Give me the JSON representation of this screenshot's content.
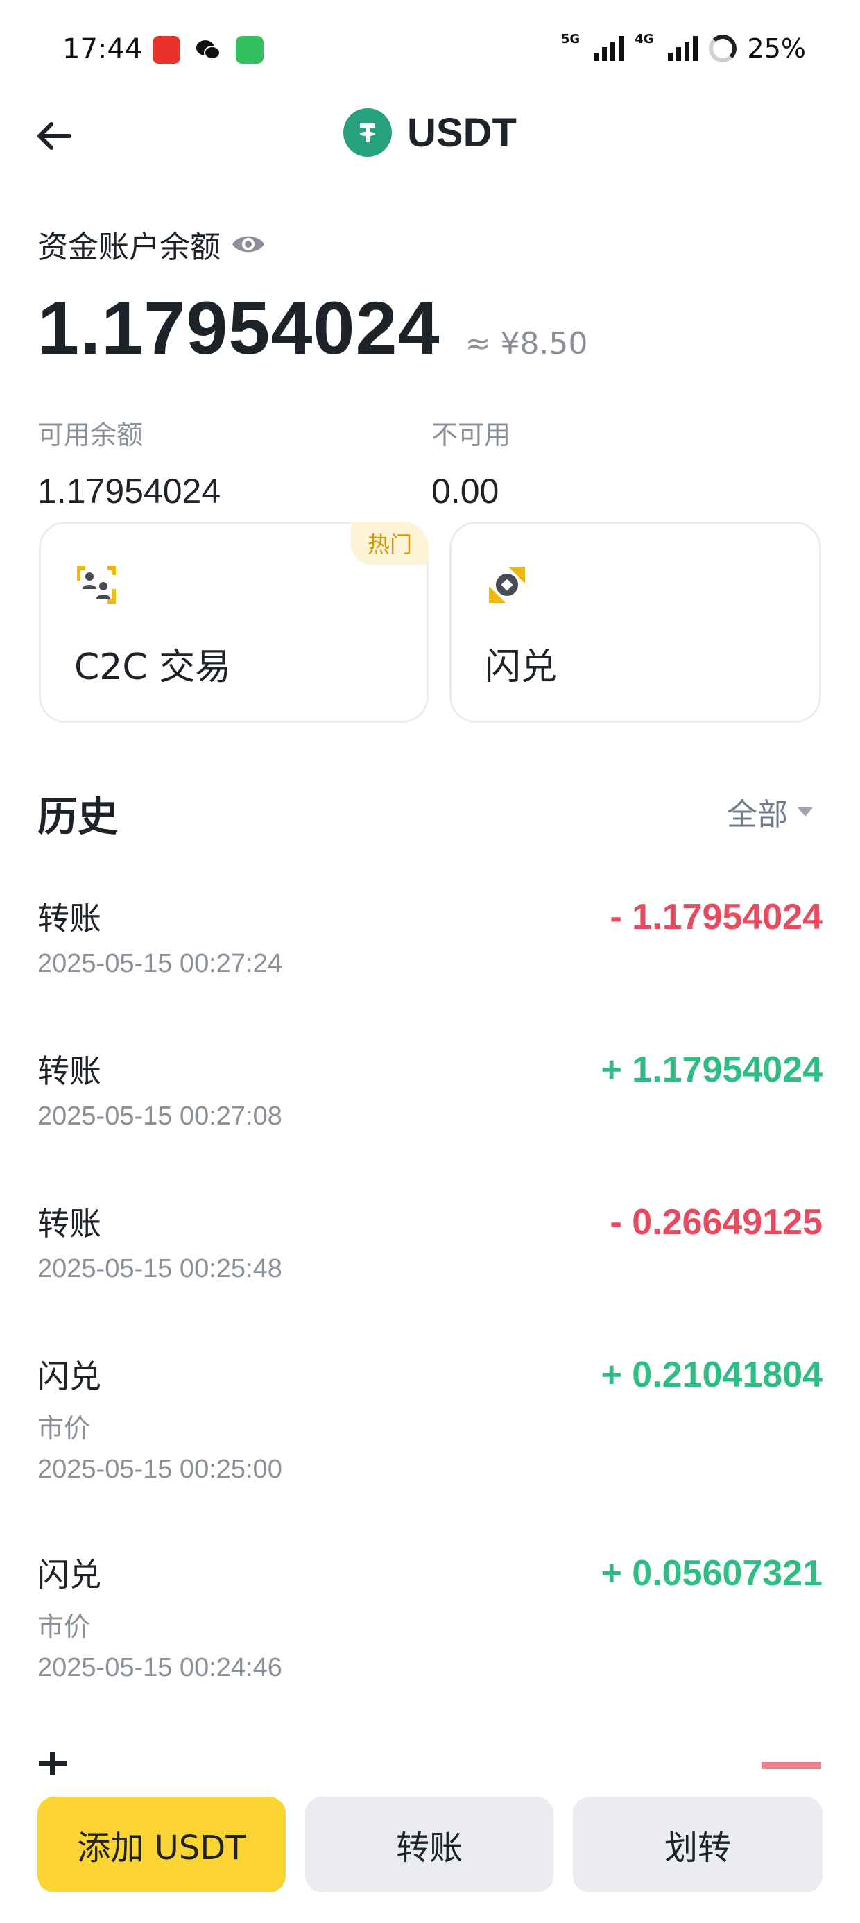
{
  "status_bar": {
    "time": "17:44",
    "network_1": "5G",
    "network_2": "4G",
    "battery": "25%"
  },
  "header": {
    "title": "USDT",
    "coin_icon": "tether-icon",
    "coin_color": "#26a17b"
  },
  "balance": {
    "label": "资金账户余额",
    "value": "1.17954024",
    "fiat": "≈ ¥8.50",
    "available_label": "可用余额",
    "available_value": "1.17954024",
    "unavailable_label": "不可用",
    "unavailable_value": "0.00"
  },
  "actions": {
    "c2c_label": "C2C 交易",
    "hot_badge": "热门",
    "flash_label": "闪兑"
  },
  "history": {
    "title": "历史",
    "filter_label": "全部",
    "items": [
      {
        "type": "转账",
        "sub": "",
        "time": "2025-05-15 00:27:24",
        "amount": "- 1.17954024"
      },
      {
        "type": "转账",
        "sub": "",
        "time": "2025-05-15 00:27:08",
        "amount": "+ 1.17954024"
      },
      {
        "type": "转账",
        "sub": "",
        "time": "2025-05-15 00:25:48",
        "amount": "- 0.26649125"
      },
      {
        "type": "闪兑",
        "sub": "市价",
        "time": "2025-05-15 00:25:00",
        "amount": "+ 0.21041804"
      },
      {
        "type": "闪兑",
        "sub": "市价",
        "time": "2025-05-15 00:24:46",
        "amount": "+ 0.05607321"
      }
    ]
  },
  "bottom_bar": {
    "add_label": "添加 USDT",
    "transfer_label": "转账",
    "move_label": "划转"
  },
  "colors": {
    "accent": "#fcd535",
    "positive": "#2ebd85",
    "negative": "#e84a60"
  }
}
